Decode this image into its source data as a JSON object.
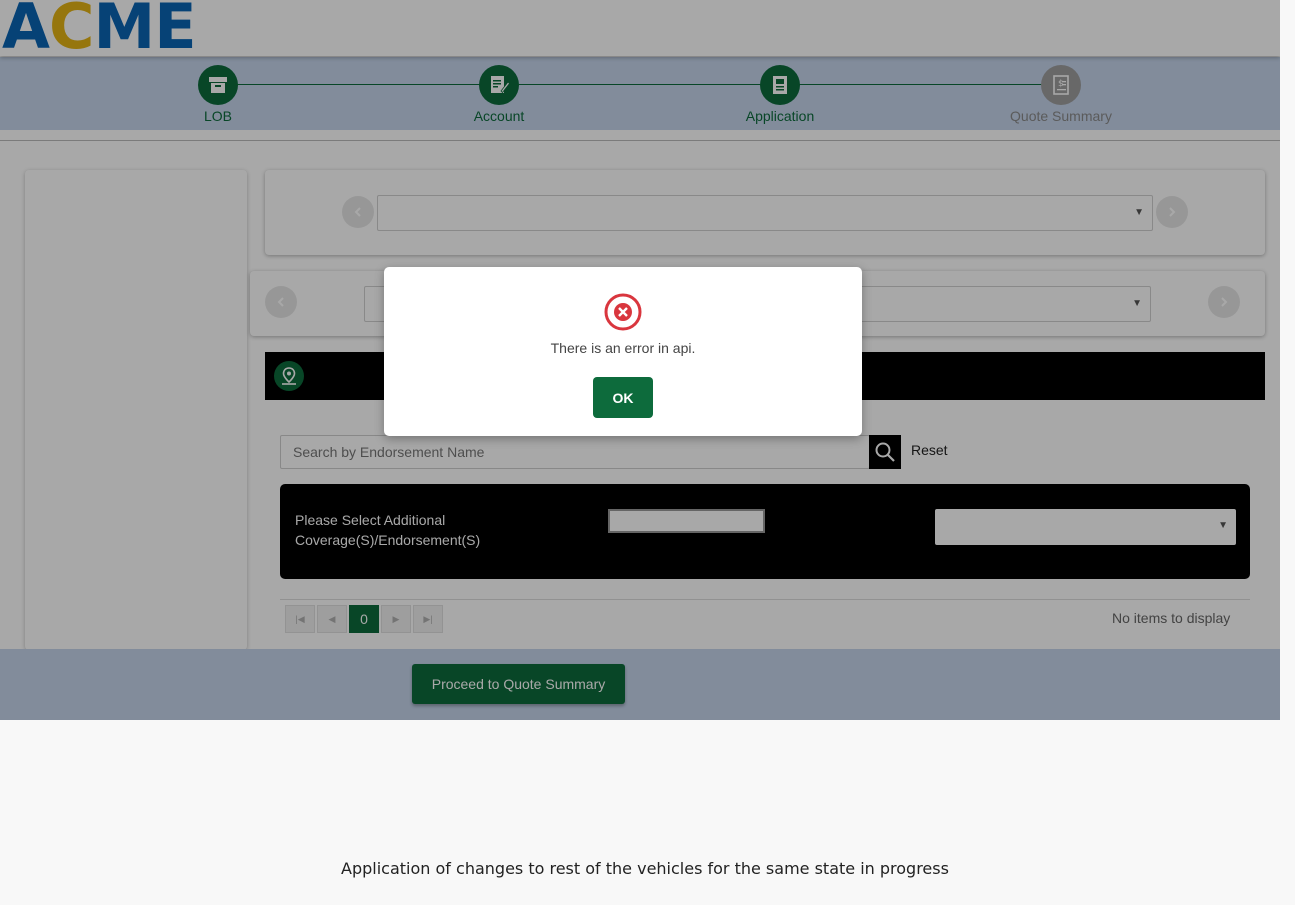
{
  "header": {
    "logo": {
      "part1": "A",
      "part2": "C",
      "part3": "ME"
    },
    "colors": {
      "blue": "#0a64b4",
      "yellow": "#e4b414"
    }
  },
  "stepper": {
    "steps": [
      {
        "label": "LOB",
        "icon": "archive-box-icon",
        "state": "complete"
      },
      {
        "label": "Account",
        "icon": "edit-document-icon",
        "state": "complete"
      },
      {
        "label": "Application",
        "icon": "document-list-icon",
        "state": "active"
      },
      {
        "label": "Quote Summary",
        "icon": "dollar-document-icon",
        "state": "inactive"
      }
    ]
  },
  "search": {
    "placeholder": "Search by Endorsement Name",
    "value": "",
    "reset_label": "Reset"
  },
  "endorsements": {
    "prompt": "Please Select Additional Coverage(S)/Endorsement(S)"
  },
  "pager": {
    "current_page": "0",
    "no_items_text": "No items to display"
  },
  "footer": {
    "proceed_label": "Proceed to Quote Summary"
  },
  "modal": {
    "message": "There is an error in api.",
    "ok_label": "OK"
  },
  "progress_message": "Application of changes to rest of the vehicles for the same state in progress",
  "theme": {
    "primary_green": "#0d6b3c",
    "stepper_bg": "#c5d5ec",
    "error_red": "#d9363e"
  }
}
